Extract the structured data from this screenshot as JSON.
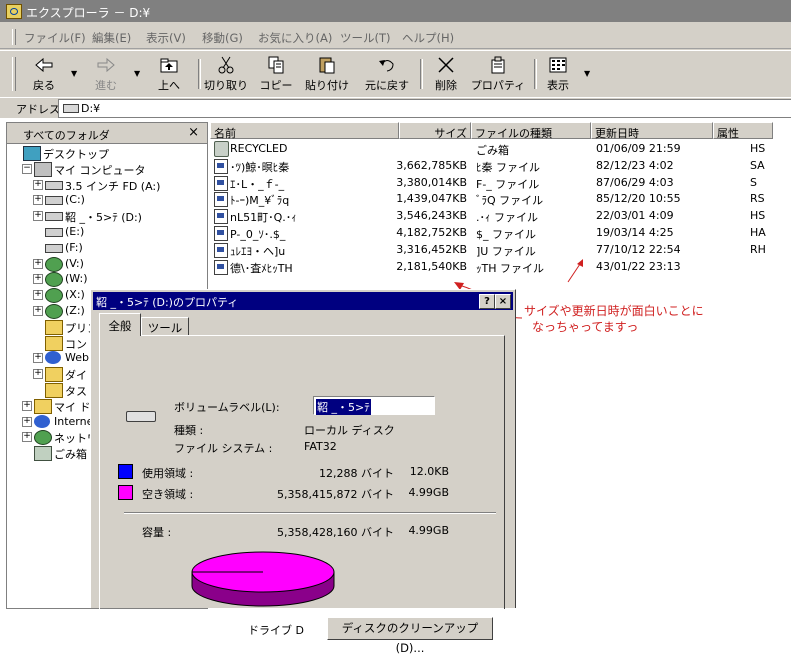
{
  "window": {
    "title": "エクスプローラ － D:¥"
  },
  "menu": [
    "ファイル(F)",
    "編集(E)",
    "表示(V)",
    "移動(G)",
    "お気に入り(A)",
    "ツール(T)",
    "ヘルプ(H)"
  ],
  "toolbar": {
    "back": "戻る",
    "forward": "進む",
    "up": "上へ",
    "cut": "切り取り",
    "copy": "コピー",
    "paste": "貼り付け",
    "undo": "元に戻す",
    "delete": "削除",
    "properties": "プロパティ",
    "view": "表示"
  },
  "address": {
    "label": "アドレス",
    "value": "D:¥"
  },
  "tree": {
    "title": "すべてのフォルダ",
    "close": "×",
    "items": [
      {
        "label": "デスクトップ",
        "icon": "desktop-icon"
      },
      {
        "label": "マイ コンピュータ",
        "icon": "computer-icon"
      },
      {
        "label": "3.5 インチ FD (A:)",
        "icon": "floppy-drive-icon"
      },
      {
        "label": "(C:)",
        "icon": "drive-icon"
      },
      {
        "label": "鞀 _・5>ﾃ (D:)",
        "icon": "drive-icon"
      },
      {
        "label": "(E:)",
        "icon": "drive-icon"
      },
      {
        "label": "(F:)",
        "icon": "drive-icon"
      },
      {
        "label": "(V:)",
        "icon": "network-drive-icon"
      },
      {
        "label": "(W:)",
        "icon": "network-drive-icon"
      },
      {
        "label": "(X:)",
        "icon": "network-drive-icon"
      },
      {
        "label": "(Z:)",
        "icon": "network-drive-icon"
      },
      {
        "label": "プリン",
        "icon": "printers-folder-icon"
      },
      {
        "label": "コントロ",
        "icon": "control-panel-icon"
      },
      {
        "label": "Web",
        "icon": "web-folder-icon"
      },
      {
        "label": "ダイ",
        "icon": "folder-icon"
      },
      {
        "label": "タス",
        "icon": "folder-icon"
      },
      {
        "label": "マイ ドキュ",
        "icon": "folder-icon"
      },
      {
        "label": "Internet",
        "icon": "internet-icon"
      },
      {
        "label": "ネットワーク",
        "icon": "network-icon"
      },
      {
        "label": "ごみ箱",
        "icon": "recycle-bin-icon"
      }
    ]
  },
  "columns": {
    "name": "名前",
    "size": "サイズ",
    "type": "ファイルの種類",
    "modified": "更新日時",
    "attr": "属性"
  },
  "files": [
    {
      "name": "RECYCLED",
      "size": "",
      "type": "ごみ箱",
      "modified": "01/06/09 21:59",
      "attr": "HS",
      "icon": "recycle-bin-icon"
    },
    {
      "name": "･ﾂ)鯨･暝ﾋ秦",
      "size": "3,662,785KB",
      "type": "ﾋ秦 ファイル",
      "modified": "82/12/23 4:02",
      "attr": "SA",
      "icon": "file-icon"
    },
    {
      "name": "ｴ･L・_ｆ-_",
      "size": "3,380,014KB",
      "type": "F-_ ファイル",
      "modified": "87/06/29 4:03",
      "attr": "S",
      "icon": "file-icon"
    },
    {
      "name": "ﾄ-ｰ)M_¥ﾞﾗq",
      "size": "1,439,047KB",
      "type": "ﾞﾗQ ファイル",
      "modified": "85/12/20 10:55",
      "attr": "RS",
      "icon": "file-icon"
    },
    {
      "name": "nL51町･Q.･ｨ",
      "size": "3,546,243KB",
      "type": ".･ｨ ファイル",
      "modified": "22/03/01 4:09",
      "attr": "HS",
      "icon": "file-icon"
    },
    {
      "name": "P-_0_ｿ･.$_",
      "size": "4,182,752KB",
      "type": "$_ ファイル",
      "modified": "19/03/14 4:25",
      "attr": "HA",
      "icon": "file-icon"
    },
    {
      "name": "ｭﾚｴﾖ・ヘ]u",
      "size": "3,316,452KB",
      "type": "]U ファイル",
      "modified": "77/10/12 22:54",
      "attr": "RH",
      "icon": "file-icon"
    },
    {
      "name": "德\\･査ﾒﾋｯTH",
      "size": "2,181,540KB",
      "type": "ｯTH ファイル",
      "modified": "43/01/22 23:13",
      "attr": "",
      "icon": "file-icon"
    }
  ],
  "dialog": {
    "title": "鞀 _・5>ﾃ (D:)のプロパティ",
    "help": "?",
    "close": "×",
    "tabs": [
      "全般",
      "ツール"
    ],
    "volume_label_label": "ボリュームラベル(L):",
    "volume_label_value": "鞀 _・5>ﾃ",
    "type_label": "種類 :",
    "type_value": "ローカル ディスク",
    "fs_label": "ファイル システム :",
    "fs_value": "FAT32",
    "used_label": "使用領域 :",
    "used_bytes": "12,288 バイト",
    "used_short": "12.0KB",
    "free_label": "空き領域 :",
    "free_bytes": "5,358,415,872 バイト",
    "free_short": "4.99GB",
    "capacity_label": "容量 :",
    "capacity_bytes": "5,358,428,160 バイト",
    "capacity_short": "4.99GB",
    "drive_caption": "ドライブ D",
    "cleanup_button": "ディスクのクリーンアップ(D)...",
    "used_color": "#0000ff",
    "free_color": "#ff00ff",
    "used_fraction": 2.3e-06
  },
  "annotation": {
    "line1": "サイズや更新日時が面白いことに",
    "line2": "なっちゃってますっ",
    "color": "#d02020"
  }
}
